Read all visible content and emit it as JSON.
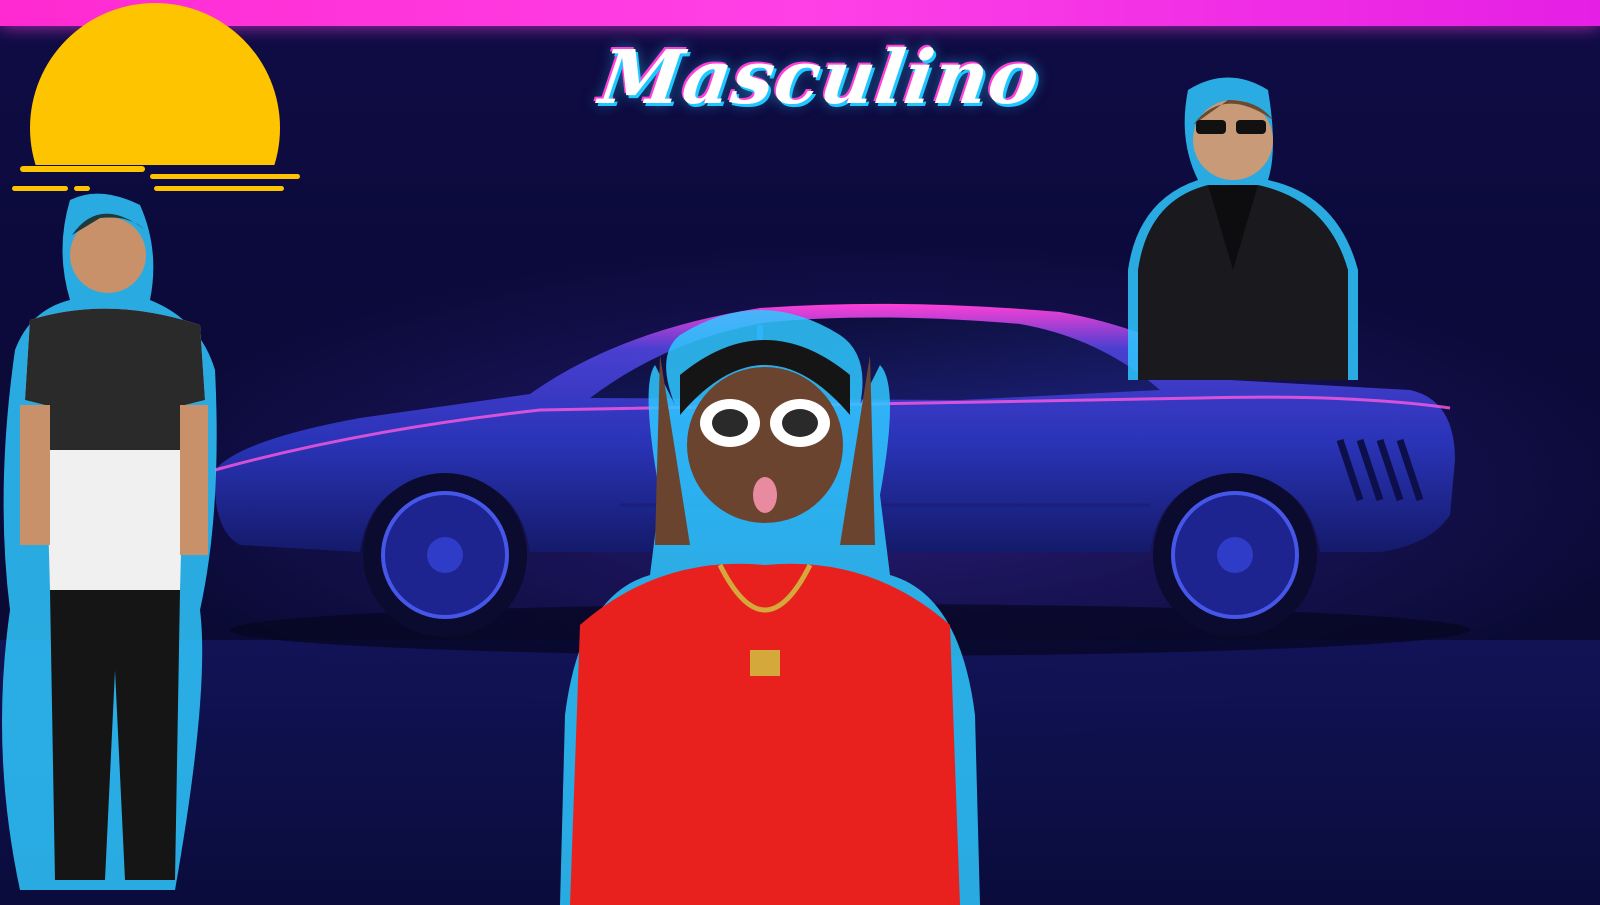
{
  "title": "Masculino",
  "colors": {
    "top_bar": "#ff2ad1",
    "sun": "#ffc400",
    "neon_cyan": "#2fc8ff",
    "neon_pink": "#ff3fd6",
    "car_body": "#2a34b8",
    "sweater": "#e8211f"
  },
  "icons": [
    "sun-icon",
    "sports-car",
    "model-tshirt",
    "model-suit",
    "model-red-sweater"
  ]
}
